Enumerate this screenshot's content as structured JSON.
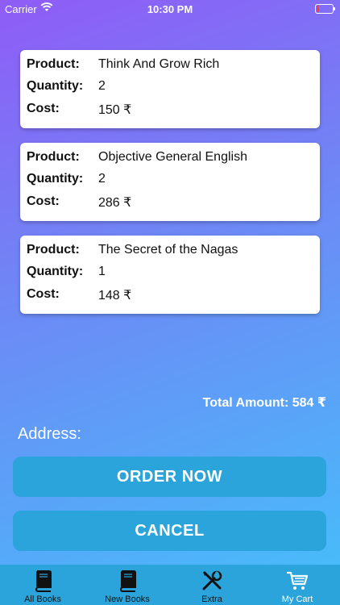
{
  "status_bar": {
    "carrier": "Carrier",
    "time": "10:30 PM",
    "battery_level": 0.15
  },
  "cart": {
    "items": [
      {
        "product_label": "Product:",
        "product": "Think And Grow Rich",
        "quantity_label": "Quantity:",
        "quantity": "2",
        "cost_label": "Cost:",
        "cost": "150 ₹"
      },
      {
        "product_label": "Product:",
        "product": "Objective General English",
        "quantity_label": "Quantity:",
        "quantity": "2",
        "cost_label": "Cost:",
        "cost": "286 ₹"
      },
      {
        "product_label": "Product:",
        "product": "The Secret of the Nagas",
        "quantity_label": "Quantity:",
        "quantity": "1",
        "cost_label": "Cost:",
        "cost": "148 ₹"
      }
    ],
    "total": "Total Amount: 584 ₹"
  },
  "address_label": "Address:",
  "buttons": {
    "order": "ORDER NOW",
    "cancel": "CANCEL"
  },
  "tabs": [
    {
      "label": "All Books",
      "icon": "book-icon"
    },
    {
      "label": "New Books",
      "icon": "book-icon"
    },
    {
      "label": "Extra",
      "icon": "tools-icon"
    },
    {
      "label": "My Cart",
      "icon": "cart-icon",
      "active": true
    }
  ],
  "colors": {
    "accent": "#2aa4db",
    "gradient_start": "#8f5cf6",
    "gradient_end": "#45c0fb"
  }
}
